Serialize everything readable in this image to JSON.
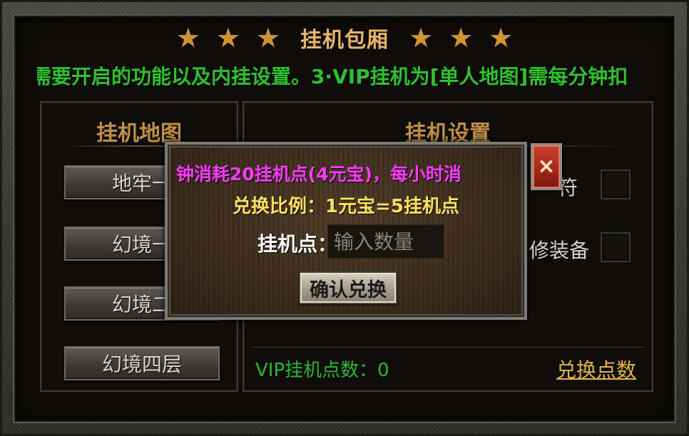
{
  "title": {
    "stars_left": [
      "★",
      "★",
      "★"
    ],
    "text": "挂机包厢",
    "stars_right": [
      "★",
      "★",
      "★"
    ]
  },
  "notice": "需要开启的功能以及内挂设置。3·VIP挂机为[单人地图]需每分钟扣",
  "left_panel": {
    "title": "挂机地图",
    "maps": [
      "地牢一",
      "幻境一",
      "幻境二",
      "幻境四层"
    ]
  },
  "right_panel": {
    "title": "挂机设置",
    "options": [
      {
        "label": "符",
        "checked": false
      },
      {
        "label": "修装备",
        "checked": false
      }
    ],
    "vip_points": "VIP挂机点数：0",
    "exchange_link": "兑换点数"
  },
  "modal": {
    "message": "钟消耗20挂机点(4元宝)，每小时消",
    "ratio": "兑换比例：1元宝=5挂机点",
    "input_label": "挂机点：",
    "input_placeholder": "输入数量",
    "confirm_label": "确认兑换",
    "close_glyph": "×"
  },
  "colors": {
    "notice": "#2fc02f",
    "title": "#e6b466",
    "panel_title": "#c08f45",
    "modal_message": "#ff3cff",
    "modal_ratio": "#ffe05c",
    "vip_points": "#2fb42f",
    "exchange_link": "#e2b444"
  }
}
